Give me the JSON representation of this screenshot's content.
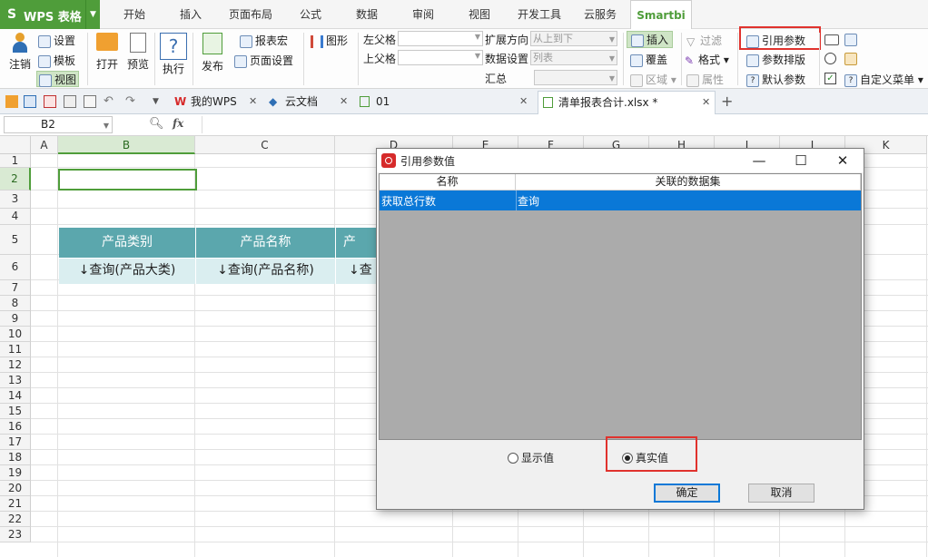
{
  "app": {
    "name": "WPS 表格"
  },
  "menu_tabs": [
    "开始",
    "插入",
    "页面布局",
    "公式",
    "数据",
    "审阅",
    "视图",
    "开发工具",
    "云服务",
    "Smartbi"
  ],
  "ribbon": {
    "logout": "注销",
    "settings": "设置",
    "template": "模板",
    "view": "视图",
    "open": "打开",
    "preview": "预览",
    "execute": "执行",
    "publish": "发布",
    "report_macro": "报表宏",
    "page_setup": "页面设置",
    "chart": "图形",
    "left_parent": "左父格",
    "top_parent": "上父格",
    "expand_dir": "扩展方向",
    "expand_value": "从上到下",
    "data_setting": "数据设置",
    "data_setting_value": "列表",
    "summary": "汇总",
    "insert": "插入",
    "cover": "覆盖",
    "area": "区域",
    "filter": "过滤",
    "format": "格式",
    "property": "属性",
    "ref_param": "引用参数",
    "param_layout": "参数排版",
    "default_param": "默认参数",
    "custom_menu": "自定义菜单"
  },
  "doc_tabs": [
    {
      "label": "我的WPS"
    },
    {
      "label": "云文档"
    },
    {
      "label": "01"
    },
    {
      "label": "清单报表合计.xlsx *"
    }
  ],
  "formula_bar": {
    "cell_ref": "B2",
    "fx": "fx"
  },
  "columns": [
    "A",
    "B",
    "C",
    "D",
    "E",
    "F",
    "G",
    "H",
    "I",
    "J",
    "K"
  ],
  "rows": [
    "1",
    "2",
    "3",
    "4",
    "5",
    "6",
    "7",
    "8",
    "9",
    "10",
    "11",
    "12",
    "13",
    "14",
    "15",
    "16",
    "17",
    "18",
    "19",
    "20",
    "21",
    "22",
    "23"
  ],
  "sheet": {
    "headers": [
      "产品类别",
      "产品名称",
      "产"
    ],
    "cells": [
      "↓查询(产品大类)",
      "↓查询(产品名称)",
      "↓查"
    ]
  },
  "dialog": {
    "title": "引用参数值",
    "col_name": "名称",
    "col_dataset": "关联的数据集",
    "row_name": "获取总行数",
    "row_dataset": "查询",
    "radio_display": "显示值",
    "radio_real": "真实值",
    "ok": "确定",
    "cancel": "取消"
  },
  "colors": {
    "brand_green": "#4f9d3a",
    "header_teal": "#5ba7ad",
    "selection_blue": "#0a78d7",
    "highlight_red": "#e0322d"
  }
}
